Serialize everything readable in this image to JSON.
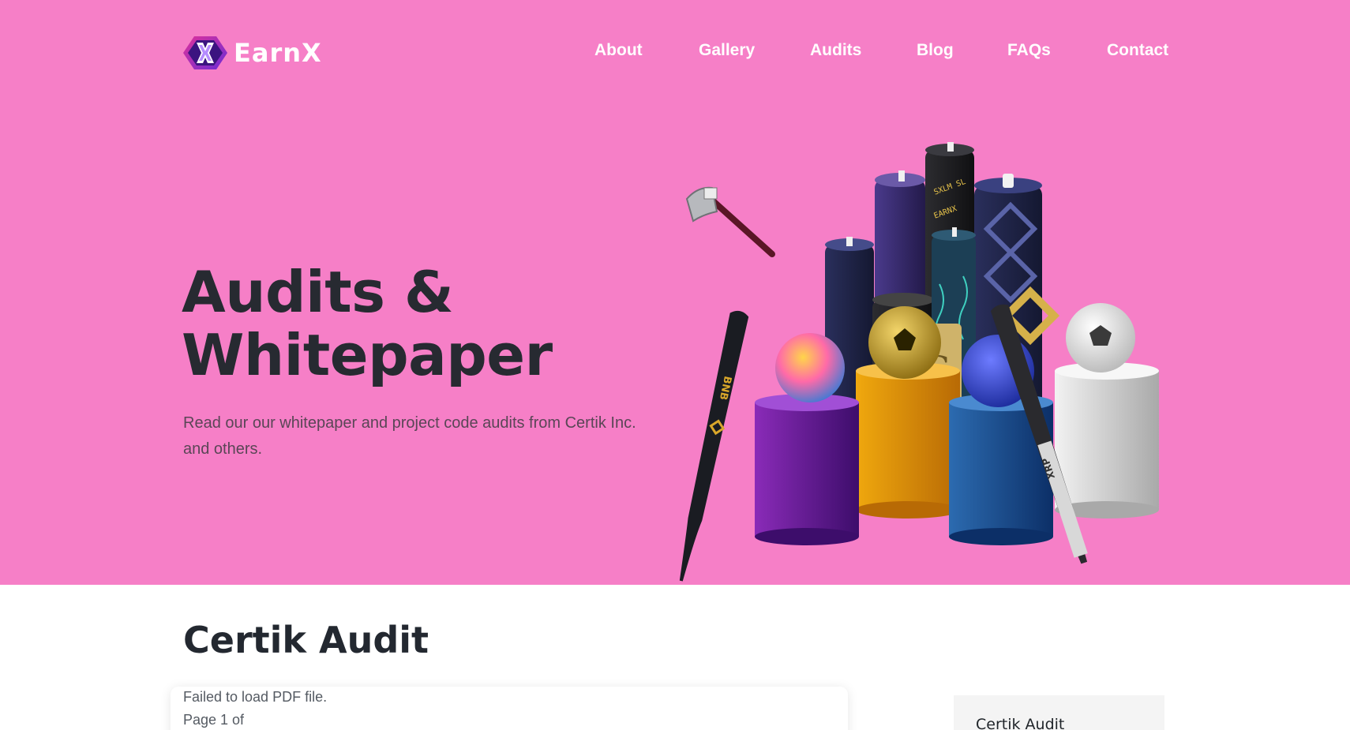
{
  "brand": {
    "name": "EarnX",
    "logo_icon": "earnx-x-logo-icon"
  },
  "nav": {
    "items": [
      {
        "label": "About"
      },
      {
        "label": "Gallery"
      },
      {
        "label": "Audits"
      },
      {
        "label": "Blog"
      },
      {
        "label": "FAQs"
      },
      {
        "label": "Contact"
      }
    ]
  },
  "hero": {
    "title_line1": "Audits &",
    "title_line2": "Whitepaper",
    "subtitle": "Read our our whitepaper and project code audits from Certik Inc. and others.",
    "illustration_labels": {
      "bat_left": "BNB",
      "bat_right": "XRP"
    }
  },
  "audit_section": {
    "title": "Certik Audit",
    "pdf_error": "Failed to load PDF file.",
    "page_indicator": "Page 1 of"
  },
  "sidebar": {
    "card_title": "Certik Audit"
  },
  "colors": {
    "hero_background": "#f67fc7",
    "heading": "#272a31",
    "nav_text": "#ffffff",
    "logo_purple": "#6a2bd6",
    "logo_magenta": "#e0329a"
  }
}
